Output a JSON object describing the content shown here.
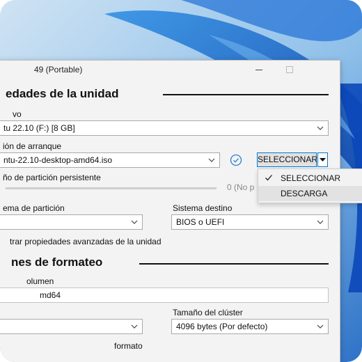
{
  "colors": {
    "accent": "#0078d4",
    "window_bg": "#f3f3f3"
  },
  "window": {
    "title": "49 (Portable)",
    "maximize_icon": "maximize-icon",
    "minimize_icon": "minimize-icon"
  },
  "drive_section": {
    "heading": "edades de la unidad",
    "device_label": "vo",
    "device_value": "tu 22.10  (F:) [8 GB]",
    "boot_label": "ión de arranque",
    "boot_value": "ntu-22.10-desktop-amd64.iso",
    "select_button": "SELECCIONAR",
    "persistent_label": "ño de partición persistente",
    "persistent_value": "0 (No p",
    "partition_label": "ema de partición",
    "target_label": "Sistema destino",
    "target_value": "BIOS o UEFI",
    "advanced_toggle": "trar propiedades avanzadas de la unidad"
  },
  "dropdown_menu": {
    "items": [
      {
        "label": "SELECCIONAR",
        "checked": true
      },
      {
        "label": "DESCARGA",
        "checked": false
      }
    ]
  },
  "format_section": {
    "heading": "nes de formateo",
    "volume_label": "olumen",
    "volume_value": "md64",
    "cluster_label": "Tamaño del clúster",
    "cluster_value": "4096 bytes (Por defecto)",
    "bottom_label": "formato"
  }
}
